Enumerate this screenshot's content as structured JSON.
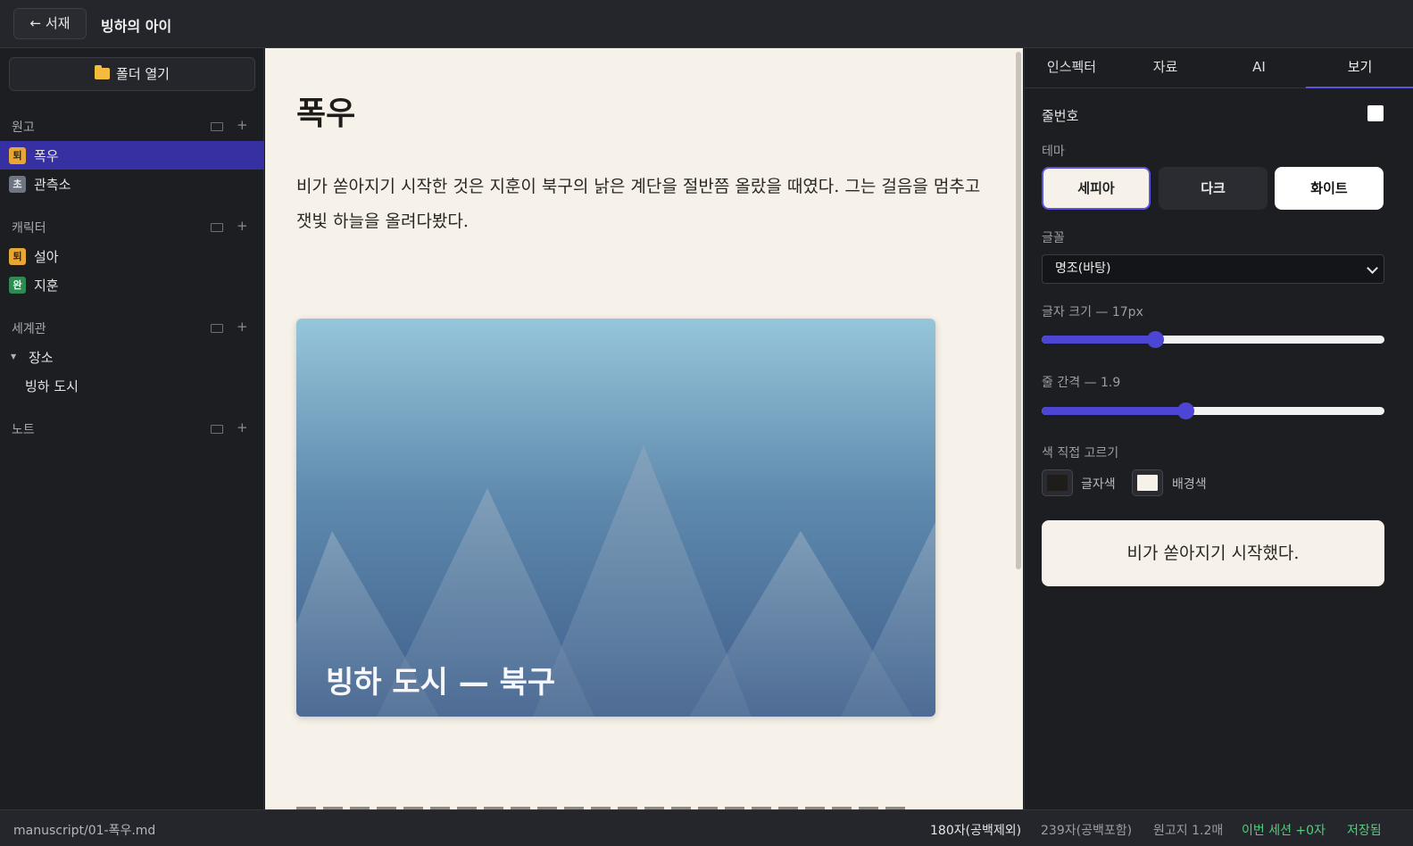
{
  "topbar": {
    "back_label": "← 서재",
    "book_title": "빙하의 아이"
  },
  "sidebar": {
    "open_folder_label": "폴더 열기",
    "sections": [
      {
        "title": "원고",
        "items": [
          {
            "badge": "퇴",
            "badge_color": "#e8a635",
            "label": "폭우",
            "active": true
          },
          {
            "badge": "초",
            "badge_color": "#6e7480",
            "label": "관측소",
            "active": false
          }
        ]
      },
      {
        "title": "캐릭터",
        "items": [
          {
            "badge": "퇴",
            "badge_color": "#e8a635",
            "label": "설아"
          },
          {
            "badge": "완",
            "badge_color": "#2f8a52",
            "label": "지훈"
          }
        ]
      },
      {
        "title": "세계관",
        "items": [
          {
            "label": "장소",
            "expanded": true
          },
          {
            "label": "빙하 도시"
          }
        ]
      },
      {
        "title": "노트",
        "items": []
      }
    ],
    "plus_symbol": "+"
  },
  "editor": {
    "title": "폭우",
    "paragraph": "비가 쏟아지기 시작한 것은 지훈이 북구의 낡은 계단을 절반쯤 올랐을 때였다. 그는 걸음을 멈추고 잿빛 하늘을 올려다봤다.",
    "image_caption": "빙하 도시 — 북구"
  },
  "right_panel": {
    "tabs": [
      "인스펙터",
      "자료",
      "AI",
      "보기"
    ],
    "active_tab": "보기",
    "line_numbers_label": "줄번호",
    "line_numbers_checked": false,
    "theme_label": "테마",
    "themes": [
      "세피아",
      "다크",
      "화이트"
    ],
    "active_theme": "세피아",
    "font_label": "글꼴",
    "font_value": "명조(바탕)",
    "font_size_label": "글자 크기 — 17px",
    "font_size_fraction": 0.33,
    "line_height_label": "줄 간격 — 1.9",
    "line_height_fraction": 0.42,
    "color_picker_label": "색 직접 고르기",
    "text_color_label": "글자색",
    "text_color": "#1f1d1a",
    "bg_color_label": "배경색",
    "bg_color": "#f6f1e9",
    "preview_text": "비가 쏟아지기 시작했다.",
    "accent": "#5b54e0"
  },
  "statusbar": {
    "path": "manuscript/01-폭우.md",
    "chars_no_space": "180자(공백제외)",
    "chars_with_space": "239자(공백포함)",
    "manuscript_pages": "원고지 1.2매",
    "session": "이번 세션 +0자",
    "saved": "저장됨"
  }
}
